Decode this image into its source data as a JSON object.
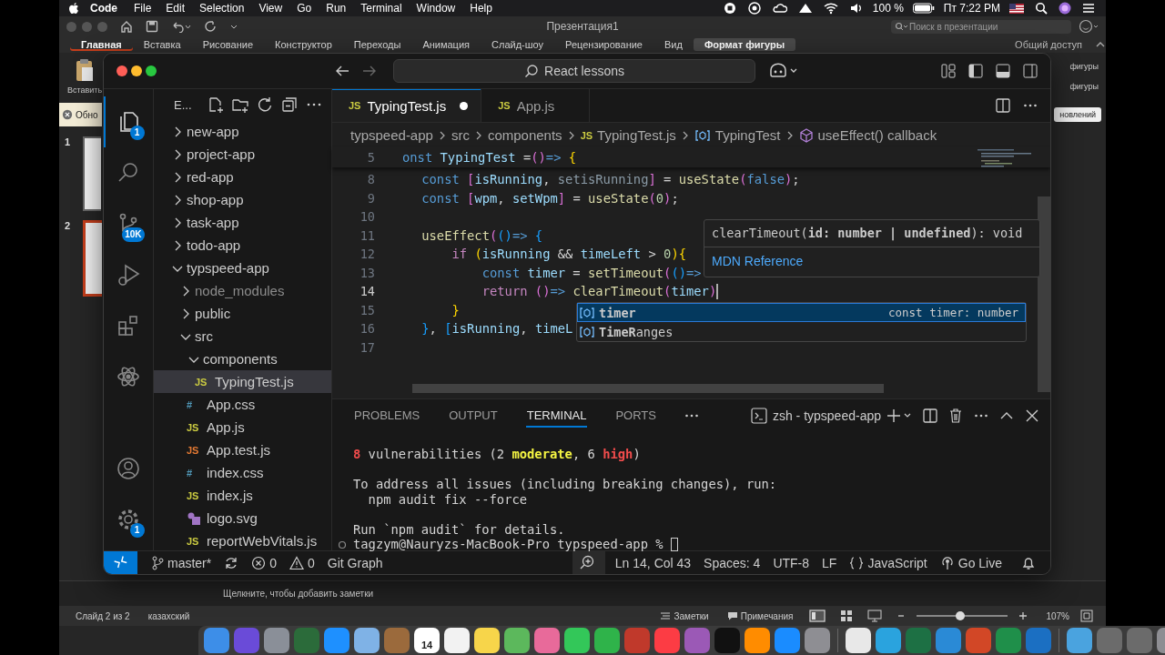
{
  "menubar": {
    "app": "Code",
    "menus": [
      "File",
      "Edit",
      "Selection",
      "View",
      "Go",
      "Run",
      "Terminal",
      "Window",
      "Help"
    ],
    "battery": "100 %",
    "clock": "Пт 7:22 PM"
  },
  "powerpoint": {
    "title": "Презентация1",
    "search": {
      "placeholder": "Поиск в презентации"
    },
    "tabs": [
      {
        "label": "Главная",
        "selected": true,
        "contextual": false
      },
      {
        "label": "Вставка",
        "selected": false,
        "contextual": false
      },
      {
        "label": "Рисование",
        "selected": false,
        "contextual": false
      },
      {
        "label": "Конструктор",
        "selected": false,
        "contextual": false
      },
      {
        "label": "Переходы",
        "selected": false,
        "contextual": false
      },
      {
        "label": "Анимация",
        "selected": false,
        "contextual": false
      },
      {
        "label": "Слайд-шоу",
        "selected": false,
        "contextual": false
      },
      {
        "label": "Рецензирование",
        "selected": false,
        "contextual": false
      },
      {
        "label": "Вид",
        "selected": false,
        "contextual": false
      },
      {
        "label": "Формат фигуры",
        "selected": false,
        "contextual": true
      }
    ],
    "share": "Общий доступ",
    "paste": "Вставить",
    "ribbon_right": [
      "фигуры",
      "фигуры"
    ],
    "message_bar": {
      "text": "Обно",
      "button": "новлений"
    },
    "slides": [
      {
        "number": "1",
        "selected": false
      },
      {
        "number": "2",
        "selected": true
      }
    ],
    "notes": {
      "placeholder": "Щелкните, чтобы добавить заметки"
    },
    "status": {
      "slide": "Слайд 2 из 2",
      "language": "казахский",
      "notes": "Заметки",
      "comments": "Примечания",
      "zoom": {
        "level": 0.48,
        "reading": "107%"
      }
    }
  },
  "dock": {
    "calendar_day": "14"
  },
  "vscode": {
    "command_center": "React lessons",
    "activity": [
      {
        "kind": "explorer",
        "badge": "1",
        "selected": true
      },
      {
        "kind": "search",
        "selected": false
      },
      {
        "kind": "source-control",
        "badge": "10K",
        "selected": false
      },
      {
        "kind": "run-debug",
        "selected": false
      },
      {
        "kind": "extensions",
        "selected": false
      },
      {
        "kind": "react",
        "selected": false
      }
    ],
    "activity_bottom": [
      {
        "kind": "account"
      },
      {
        "kind": "settings",
        "badge": "1"
      }
    ],
    "explorer": {
      "title": "E...",
      "tree": [
        {
          "label": "new-app",
          "kind": "folder",
          "expanded": false,
          "selected": false,
          "dimmed": false
        },
        {
          "label": "project-app",
          "kind": "folder",
          "expanded": false,
          "selected": false,
          "dimmed": false
        },
        {
          "label": "red-app",
          "kind": "folder",
          "expanded": false,
          "selected": false,
          "dimmed": false
        },
        {
          "label": "shop-app",
          "kind": "folder",
          "expanded": false,
          "selected": false,
          "dimmed": false
        },
        {
          "label": "task-app",
          "kind": "folder",
          "expanded": false,
          "selected": false,
          "dimmed": false
        },
        {
          "label": "todo-app",
          "kind": "folder",
          "expanded": false,
          "selected": false,
          "dimmed": false
        },
        {
          "label": "typspeed-app",
          "kind": "folder",
          "expanded": true,
          "selected": false,
          "dimmed": false,
          "children": [
            {
              "label": "node_modules",
              "kind": "folder",
              "expanded": false,
              "selected": false,
              "dimmed": true
            },
            {
              "label": "public",
              "kind": "folder",
              "expanded": false,
              "selected": false,
              "dimmed": false
            },
            {
              "label": "src",
              "kind": "folder",
              "expanded": true,
              "selected": false,
              "dimmed": false,
              "children": [
                {
                  "label": "components",
                  "kind": "folder",
                  "expanded": true,
                  "selected": false,
                  "dimmed": false,
                  "children": [
                    {
                      "label": "TypingTest.js",
                      "kind": "js",
                      "icon": "JS",
                      "selected": true,
                      "dimmed": false
                    }
                  ]
                },
                {
                  "label": "App.css",
                  "kind": "css",
                  "icon": "#",
                  "selected": false,
                  "dimmed": false
                },
                {
                  "label": "App.js",
                  "kind": "js",
                  "icon": "JS",
                  "selected": false,
                  "dimmed": false
                },
                {
                  "label": "App.test.js",
                  "kind": "test",
                  "icon": "JS",
                  "selected": false,
                  "dimmed": false
                },
                {
                  "label": "index.css",
                  "kind": "css",
                  "icon": "#",
                  "selected": false,
                  "dimmed": false
                },
                {
                  "label": "index.js",
                  "kind": "js",
                  "icon": "JS",
                  "selected": false,
                  "dimmed": false
                },
                {
                  "label": "logo.svg",
                  "kind": "svg",
                  "selected": false,
                  "dimmed": false
                },
                {
                  "label": "reportWebVitals.js",
                  "kind": "js",
                  "icon": "JS",
                  "selected": false,
                  "dimmed": false
                }
              ]
            }
          ]
        }
      ]
    },
    "tabs": [
      {
        "label": "TypingTest.js",
        "icon": "JS",
        "selected": true,
        "modified": true
      },
      {
        "label": "App.js",
        "icon": "JS",
        "selected": false,
        "modified": false
      }
    ],
    "breadcrumbs": [
      {
        "label": "typspeed-app",
        "kind": "folder"
      },
      {
        "label": "src",
        "kind": "folder"
      },
      {
        "label": "components",
        "kind": "folder"
      },
      {
        "label": "TypingTest.js",
        "kind": "file",
        "icon": "JS"
      },
      {
        "label": "TypingTest",
        "kind": "variable"
      },
      {
        "label": "useEffect() callback",
        "kind": "method"
      }
    ],
    "sticky_line": {
      "number": "5",
      "tokens": [
        {
          "text": "onst",
          "kind": "kw"
        },
        {
          "text": " TypingTest ",
          "kind": "var"
        },
        {
          "text": "=",
          "kind": "p"
        },
        {
          "text": "()",
          "kind": "b2"
        },
        {
          "text": "=>",
          "kind": "kw"
        },
        {
          "text": " {",
          "kind": "b1"
        }
      ]
    },
    "lines": [
      {
        "number": "8",
        "tokens": [
          {
            "text": "    const",
            "kind": "kw"
          },
          {
            "text": " [",
            "kind": "b2"
          },
          {
            "text": "isRunning",
            "kind": "var"
          },
          {
            "text": ", ",
            "kind": "p"
          },
          {
            "text": "setisRunning",
            "kind": "dim"
          },
          {
            "text": "]",
            "kind": "b2"
          },
          {
            "text": " = ",
            "kind": "p"
          },
          {
            "text": "useState",
            "kind": "fn"
          },
          {
            "text": "(",
            "kind": "b2"
          },
          {
            "text": "false",
            "kind": "kw"
          },
          {
            "text": ")",
            "kind": "b2"
          },
          {
            "text": ";",
            "kind": "p"
          }
        ]
      },
      {
        "number": "9",
        "tokens": [
          {
            "text": "    const",
            "kind": "kw"
          },
          {
            "text": " [",
            "kind": "b2"
          },
          {
            "text": "wpm",
            "kind": "var"
          },
          {
            "text": ", ",
            "kind": "p"
          },
          {
            "text": "setWpm",
            "kind": "var"
          },
          {
            "text": "]",
            "kind": "b2"
          },
          {
            "text": " = ",
            "kind": "p"
          },
          {
            "text": "useState",
            "kind": "fn"
          },
          {
            "text": "(",
            "kind": "b2"
          },
          {
            "text": "0",
            "kind": "num"
          },
          {
            "text": ")",
            "kind": "b2"
          },
          {
            "text": ";",
            "kind": "p"
          }
        ]
      },
      {
        "number": "10"
      },
      {
        "number": "11",
        "tokens": [
          {
            "text": "    useEffect",
            "kind": "fn"
          },
          {
            "text": "(",
            "kind": "b2"
          },
          {
            "text": "()",
            "kind": "b3"
          },
          {
            "text": "=>",
            "kind": "kw"
          },
          {
            "text": " {",
            "kind": "b3"
          }
        ]
      },
      {
        "number": "12",
        "tokens": [
          {
            "text": "        if",
            "kind": "ctl"
          },
          {
            "text": " (",
            "kind": "b1"
          },
          {
            "text": "isRunning",
            "kind": "var"
          },
          {
            "text": " && ",
            "kind": "p"
          },
          {
            "text": "timeLeft",
            "kind": "var"
          },
          {
            "text": " > ",
            "kind": "p"
          },
          {
            "text": "0",
            "kind": "num"
          },
          {
            "text": ")",
            "kind": "b1"
          },
          {
            "text": "{",
            "kind": "b1"
          }
        ]
      },
      {
        "number": "13",
        "tokens": [
          {
            "text": "            const",
            "kind": "kw"
          },
          {
            "text": " timer",
            "kind": "var"
          },
          {
            "text": " = ",
            "kind": "p"
          },
          {
            "text": "setTimeout",
            "kind": "fn"
          },
          {
            "text": "(",
            "kind": "b2"
          },
          {
            "text": "()",
            "kind": "b3"
          },
          {
            "text": "=>",
            "kind": "kw"
          }
        ]
      },
      {
        "number": "14",
        "current": true,
        "tokens": [
          {
            "text": "            return",
            "kind": "ctl"
          },
          {
            "text": " ()",
            "kind": "b2"
          },
          {
            "text": "=>",
            "kind": "kw"
          },
          {
            "text": " clearTimeout",
            "kind": "fn"
          },
          {
            "text": "(",
            "kind": "b2"
          },
          {
            "text": "timer",
            "kind": "var"
          },
          {
            "text": ")",
            "kind": "b2"
          }
        ]
      },
      {
        "number": "15",
        "tokens": [
          {
            "text": "        }",
            "kind": "b1"
          }
        ]
      },
      {
        "number": "16",
        "tokens": [
          {
            "text": "    }",
            "kind": "b3"
          },
          {
            "text": ", ",
            "kind": "p"
          },
          {
            "text": "[",
            "kind": "b3"
          },
          {
            "text": "isRunning",
            "kind": "var"
          },
          {
            "text": ", ",
            "kind": "p"
          },
          {
            "text": "timeL",
            "kind": "var"
          }
        ]
      },
      {
        "number": "17"
      }
    ],
    "hover": {
      "signature": "clearTimeout(**id: number | undefined**): void",
      "link": "MDN Reference"
    },
    "suggestions": [
      {
        "label": "**timer**",
        "detail": "const timer: number",
        "selected": true
      },
      {
        "label": "**TimeR**anges",
        "selected": false
      }
    ],
    "panel": {
      "tabs": [
        {
          "label": "PROBLEMS",
          "selected": false
        },
        {
          "label": "OUTPUT",
          "selected": false
        },
        {
          "label": "TERMINAL",
          "selected": true
        },
        {
          "label": "PORTS",
          "selected": false
        }
      ],
      "terminal_name": "zsh - typspeed-app",
      "lines": [
        {
          "kind": "text",
          "tokens": [
            {
              "text": "8",
              "kind": "red"
            },
            {
              "text": " vulnerabilities (2 ",
              "kind": "p"
            },
            {
              "text": "moderate",
              "kind": "yellow"
            },
            {
              "text": ", 6 ",
              "kind": "p"
            },
            {
              "text": "high",
              "kind": "red"
            },
            {
              "text": ")",
              "kind": "p"
            }
          ]
        },
        {
          "kind": "blank"
        },
        {
          "kind": "text",
          "tokens": [
            {
              "text": "To address all issues (including breaking changes), run:",
              "kind": "p"
            }
          ]
        },
        {
          "kind": "text",
          "tokens": [
            {
              "text": "  npm audit fix --force",
              "kind": "p"
            }
          ]
        },
        {
          "kind": "blank"
        },
        {
          "kind": "text",
          "tokens": [
            {
              "text": "Run `npm audit` for details.",
              "kind": "p"
            }
          ]
        },
        {
          "kind": "prompt",
          "tokens": [
            {
              "text": "tagzym@Nauryzs-MacBook-Pro typspeed-app % ",
              "kind": "p"
            }
          ]
        }
      ]
    },
    "status": {
      "branch": "master*",
      "errors": "0",
      "warnings": "0",
      "git_graph": "Git Graph",
      "position": "Ln 14, Col 43",
      "spaces": "Spaces: 4",
      "encoding": "UTF-8",
      "eol": "LF",
      "language": "JavaScript",
      "go_live": "Go Live"
    }
  }
}
